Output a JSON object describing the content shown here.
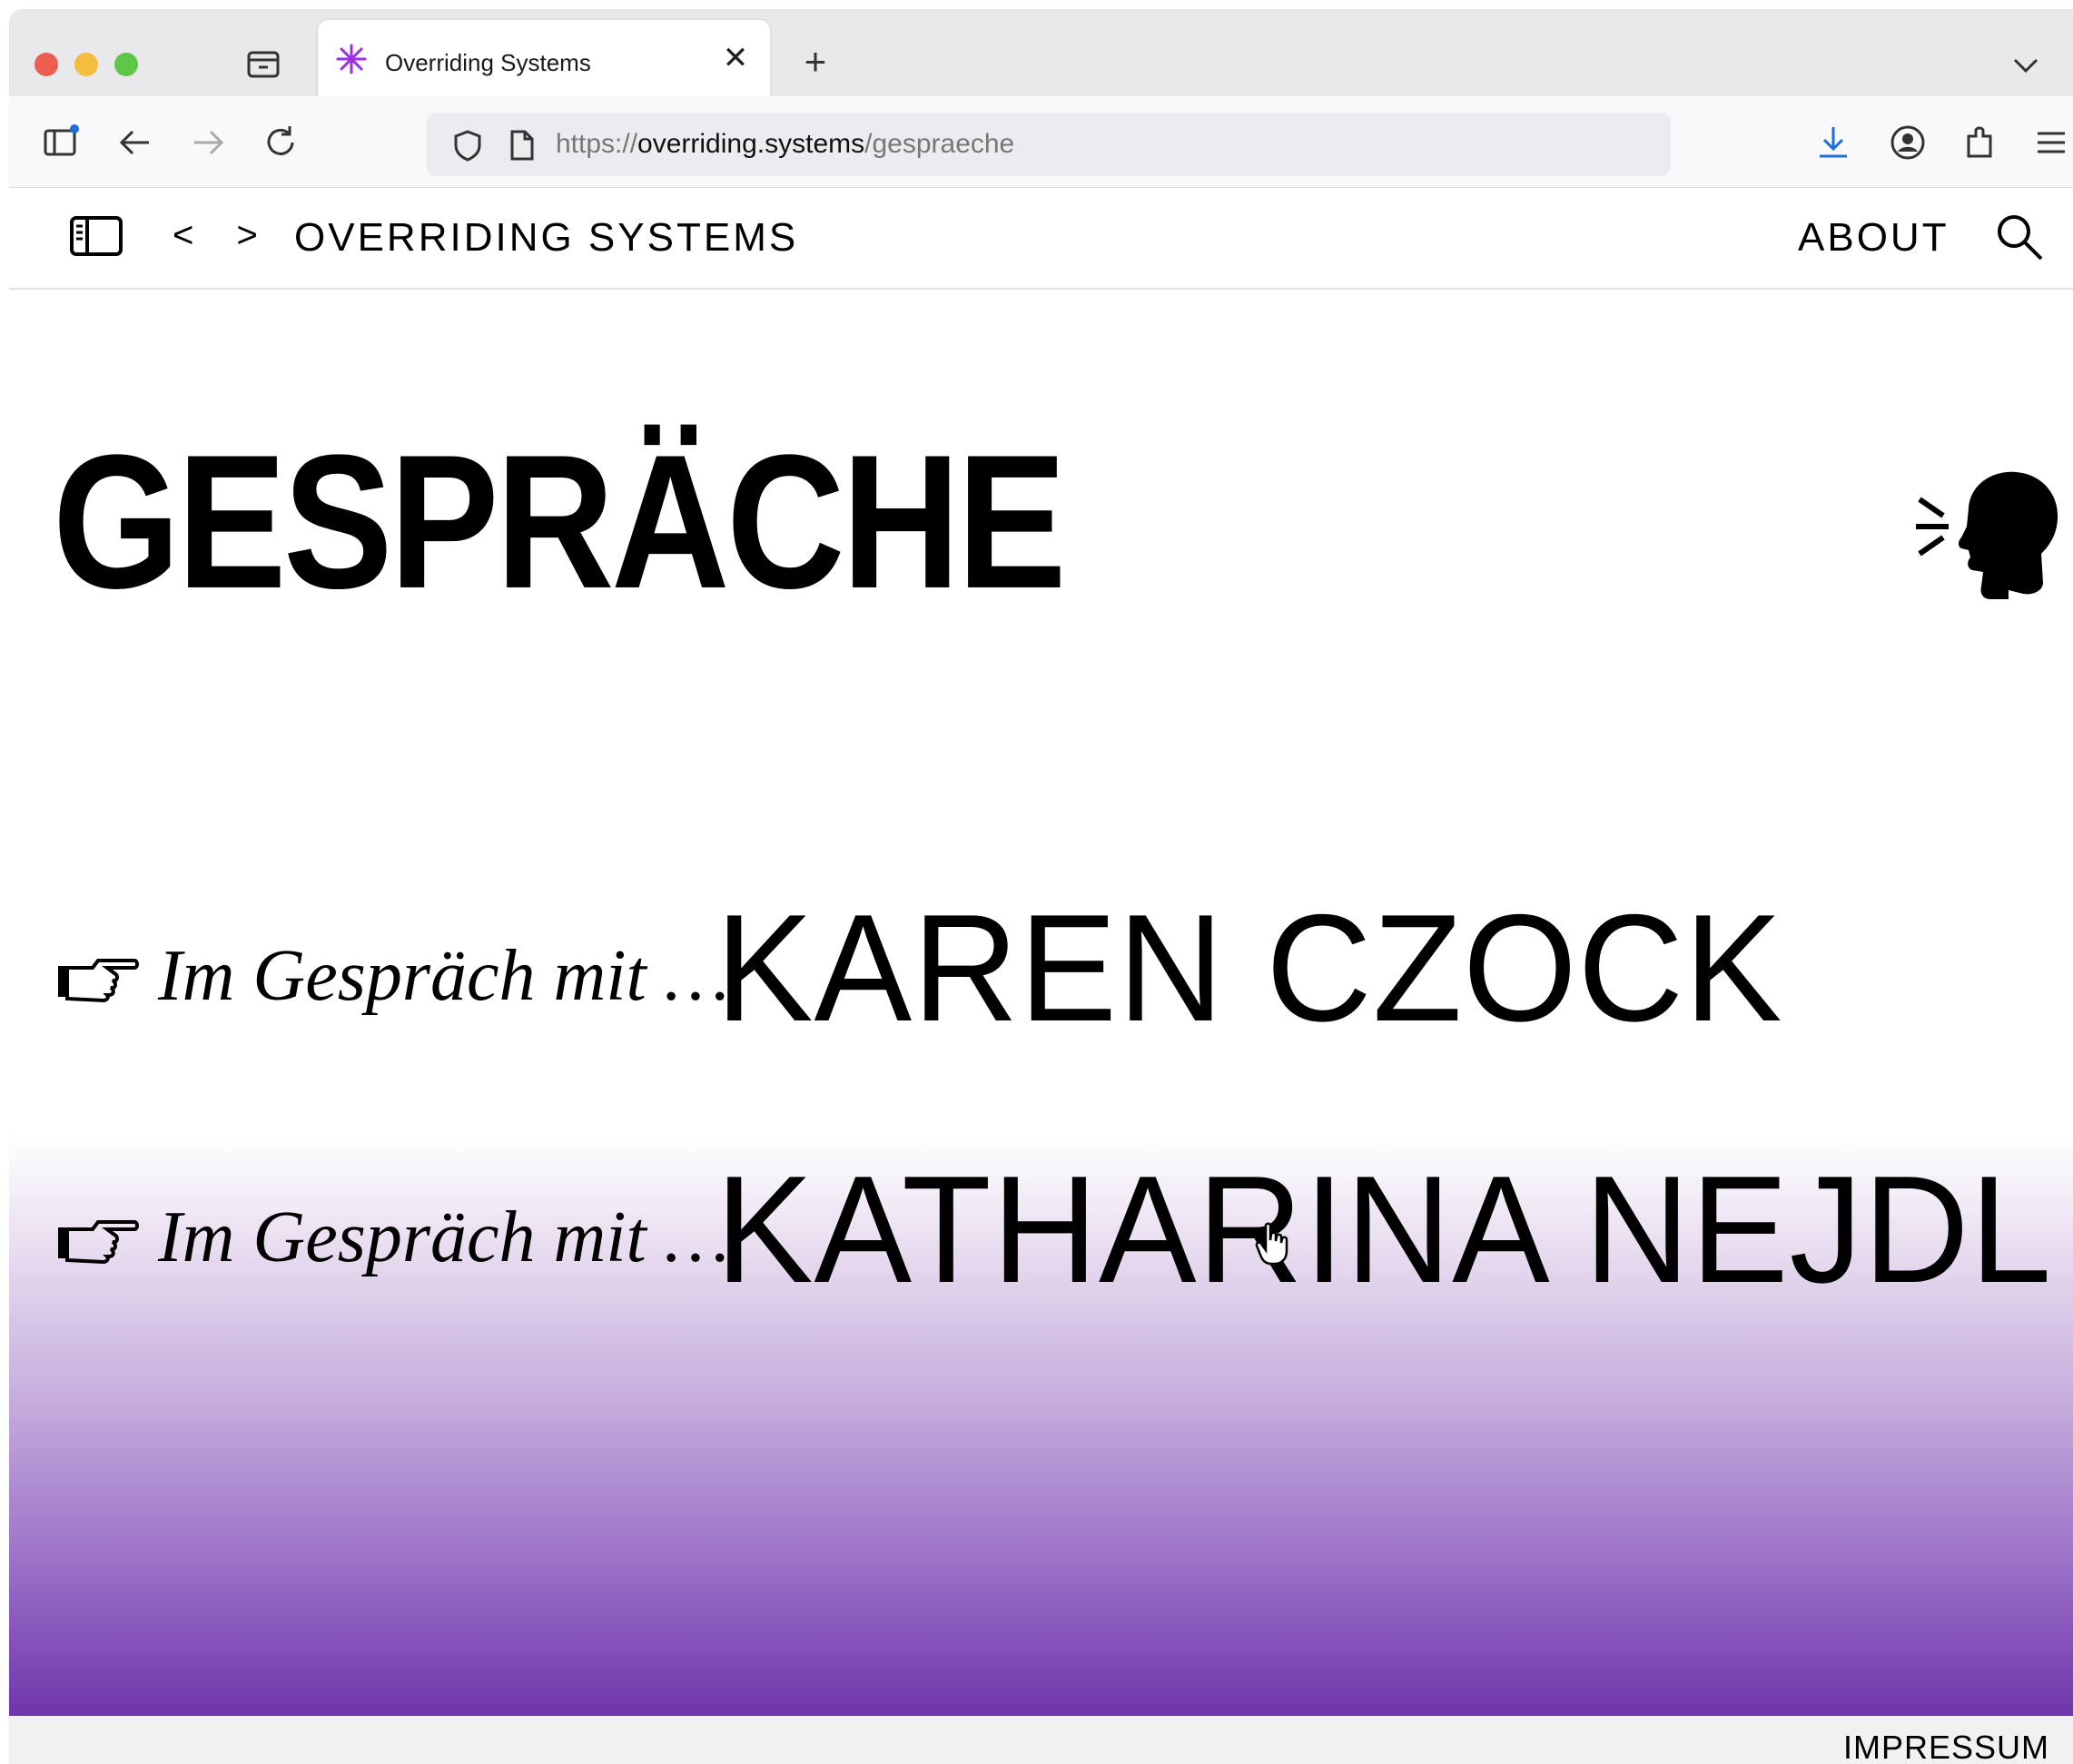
{
  "browser": {
    "tab_title": "Overriding Systems",
    "tab_close_glyph": "✕",
    "new_tab_glyph": "+",
    "url_prefix": "https://",
    "url_domain": "overriding.systems",
    "url_path": "/gespraeche"
  },
  "site_header": {
    "back_next": "< >",
    "title": "OVERRIDING SYSTEMS",
    "about_label": "ABOUT"
  },
  "page": {
    "heading": "GESPRÄCHE",
    "entries": [
      {
        "intro": "Im Gespräch mit …",
        "name": "KAREN CZOCK"
      },
      {
        "intro": "Im Gespräch mit …",
        "name": "KATHARINA NEJDL"
      }
    ]
  },
  "footer": {
    "impressum_label": "IMPRESSUM"
  },
  "colors": {
    "accent_purple": "#7a3cb0",
    "favicon_purple": "#9b30e0",
    "download_blue": "#1a6fd8",
    "traffic_red": "#ee5c52",
    "traffic_yellow": "#f5bd3f",
    "traffic_green": "#5ec747"
  },
  "icons": [
    "tab-overview-icon",
    "favicon-asterisk-icon",
    "chevron-down-icon",
    "sidebar-icon",
    "back-arrow-icon",
    "forward-arrow-icon",
    "reload-icon",
    "shield-icon",
    "page-icon",
    "download-icon",
    "account-icon",
    "extensions-icon",
    "menu-icon",
    "sidebar-toggle-icon",
    "search-icon",
    "speaking-head-icon",
    "pointing-hand-icon",
    "hand-cursor-icon"
  ]
}
